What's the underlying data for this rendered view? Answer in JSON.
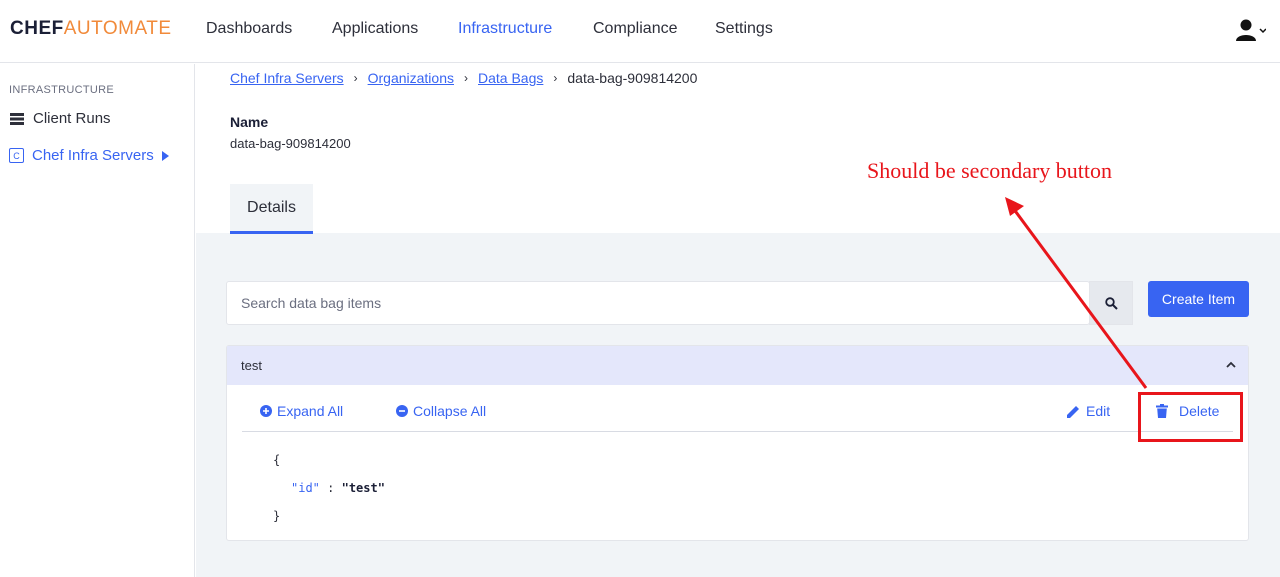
{
  "logo": {
    "part1": "CHEF",
    "part2": "AUTOMATE"
  },
  "nav": {
    "items": [
      {
        "label": "Dashboards"
      },
      {
        "label": "Applications"
      },
      {
        "label": "Infrastructure"
      },
      {
        "label": "Compliance"
      },
      {
        "label": "Settings"
      }
    ],
    "active": "Infrastructure",
    "user_icon": "user-icon"
  },
  "sidebar": {
    "heading": "INFRASTRUCTURE",
    "items": [
      {
        "label": "Client Runs",
        "icon": "list-icon"
      },
      {
        "label": "Chef Infra Servers",
        "icon": "c-badge-icon",
        "badge": "C"
      }
    ]
  },
  "breadcrumb": {
    "links": [
      "Chef Infra Servers",
      "Organizations",
      "Data Bags"
    ],
    "current": "data-bag-909814200"
  },
  "details": {
    "name_label": "Name",
    "name_value": "data-bag-909814200"
  },
  "tabs": [
    {
      "label": "Details"
    }
  ],
  "search": {
    "placeholder": "Search data bag items",
    "value": ""
  },
  "create_button": "Create Item",
  "item": {
    "title": "test",
    "expand_all": "Expand All",
    "collapse_all": "Collapse All",
    "edit": "Edit",
    "delete": "Delete",
    "json": {
      "open": "{",
      "key": "\"id\"",
      "colon": ":",
      "value": "\"test\"",
      "close": "}"
    }
  },
  "annotation": {
    "text": "Should be secondary button",
    "color": "#e8151b"
  },
  "colors": {
    "accent": "#3864f2",
    "brand_orange": "#f18a3a",
    "annotation": "#e8151b"
  }
}
